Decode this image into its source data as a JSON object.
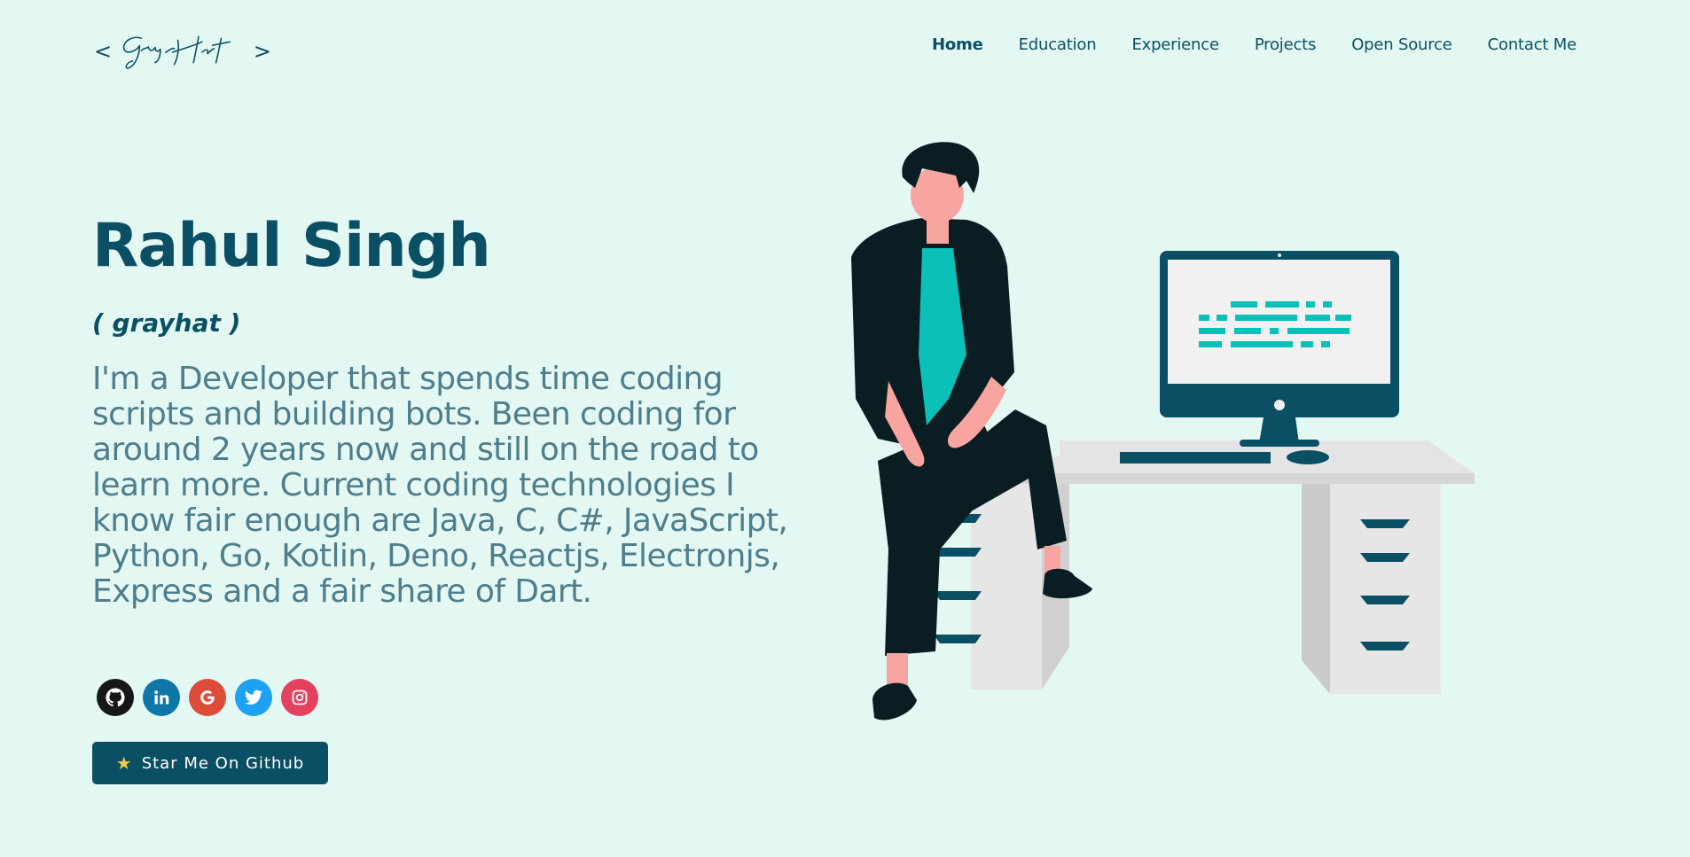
{
  "header": {
    "logo": {
      "open": "<",
      "close": ">",
      "signature": "grayhat"
    },
    "nav": [
      {
        "label": "Home",
        "active": true
      },
      {
        "label": "Education",
        "active": false
      },
      {
        "label": "Experience",
        "active": false
      },
      {
        "label": "Projects",
        "active": false
      },
      {
        "label": "Open Source",
        "active": false
      },
      {
        "label": "Contact Me",
        "active": false
      }
    ]
  },
  "hero": {
    "name": "Rahul Singh",
    "nickname": "( grayhat )",
    "description": "I'm a Developer that spends time coding scripts and building bots. Been coding for around 2 years now and still on the road to learn more. Current coding technologies I know fair enough are Java, C, C#, JavaScript, Python, Go, Kotlin, Deno, Reactjs, Electronjs, Express and a fair share of Dart.",
    "socials": [
      {
        "icon": "github-icon",
        "color": "#181717"
      },
      {
        "icon": "linkedin-icon",
        "color": "#0e76a8"
      },
      {
        "icon": "google-icon",
        "color": "#dd4b39"
      },
      {
        "icon": "twitter-icon",
        "color": "#1da1f2"
      },
      {
        "icon": "instagram-icon",
        "color": "#e4405f"
      }
    ],
    "star_button": {
      "icon": "star-icon",
      "label": "Star Me On Github"
    }
  },
  "theme": {
    "background": "#e3f8f3",
    "primary": "#0b4f64",
    "text_secondary": "#4e7d8c",
    "accent": "#0ac0b8"
  }
}
